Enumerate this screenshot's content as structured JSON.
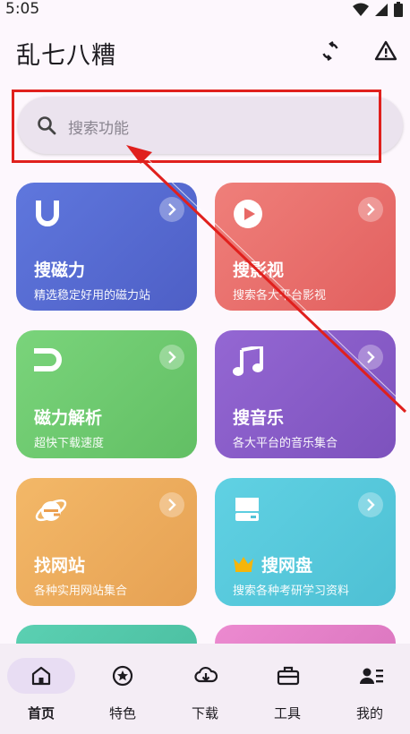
{
  "status_bar": {
    "time": "5:05"
  },
  "header": {
    "title": "乱七八糟"
  },
  "search": {
    "placeholder": "搜索功能"
  },
  "cards": [
    {
      "title": "搜磁力",
      "subtitle": "精选稳定好用的磁力站",
      "icon": "magnet-u-icon",
      "color": "#5b6ed3"
    },
    {
      "title": "搜影视",
      "subtitle": "搜索各大平台影视",
      "icon": "play-circle-icon",
      "color": "#ea6f6c"
    },
    {
      "title": "磁力解析",
      "subtitle": "超快下载速度",
      "icon": "magnet-icon",
      "color": "#6ec96f"
    },
    {
      "title": "搜音乐",
      "subtitle": "各大平台的音乐集合",
      "icon": "music-note-icon",
      "color": "#8a5dc8"
    },
    {
      "title": "找网站",
      "subtitle": "各种实用网站集合",
      "icon": "ie-browser-icon",
      "color": "#efad5c"
    },
    {
      "title": "搜网盘",
      "subtitle": "搜索各种考研学习资料",
      "icon": "disk-drive-icon",
      "color": "#59c8dc"
    }
  ],
  "nav": {
    "items": [
      {
        "label": "首页",
        "icon": "home-icon",
        "active": true
      },
      {
        "label": "特色",
        "icon": "star-circle-icon"
      },
      {
        "label": "下载",
        "icon": "cloud-download-icon"
      },
      {
        "label": "工具",
        "icon": "toolbox-icon"
      },
      {
        "label": "我的",
        "icon": "profile-list-icon"
      }
    ]
  },
  "colors": {
    "highlight": "#e0201d",
    "background": "#fdf7fd",
    "nav_active": "#e8ddf3"
  }
}
